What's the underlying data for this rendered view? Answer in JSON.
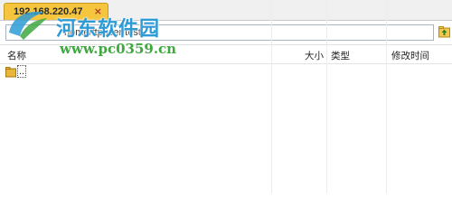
{
  "tab": {
    "title": "192.168.220.47",
    "close_glyph": "×"
  },
  "path": {
    "value": "home/ftpuser/test"
  },
  "columns": {
    "name": "名称",
    "size": "大小",
    "type": "类型",
    "modified": "修改时间"
  },
  "rows": [
    {
      "name": "..",
      "icon": "folder-icon"
    }
  ],
  "watermark": {
    "brand": "河东软件园",
    "url": "www.pc0359.cn"
  },
  "colors": {
    "tab_active": "#f6c53e",
    "folder": "#e8b73a",
    "watermark_blue": "#2e9bd6",
    "watermark_green": "#3fa83f"
  }
}
